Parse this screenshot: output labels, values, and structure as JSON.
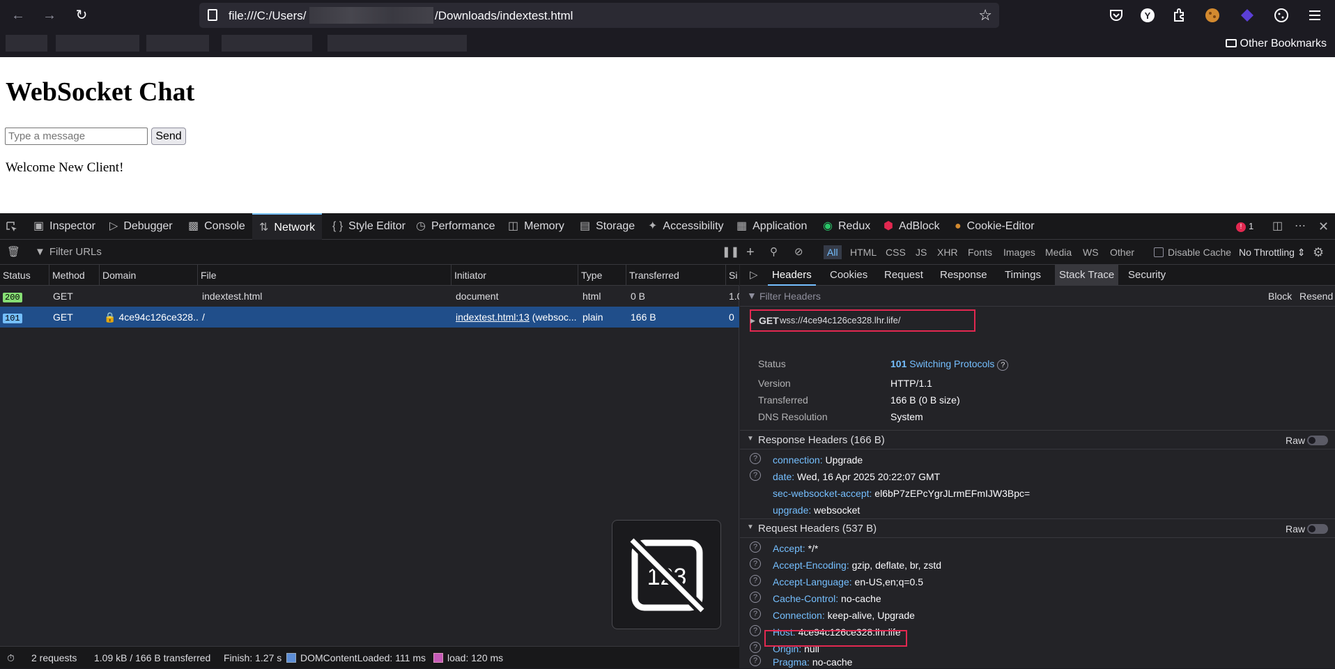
{
  "browser": {
    "url_prefix": "file:///C:/Users/",
    "url_suffix": "/Downloads/indextest.html",
    "bookmarks": {
      "other": "Other Bookmarks"
    }
  },
  "page": {
    "title": "WebSocket Chat",
    "message_placeholder": "Type a message",
    "send_label": "Send",
    "welcome": "Welcome New Client!"
  },
  "devtools": {
    "tabs": [
      "Inspector",
      "Debugger",
      "Console",
      "Network",
      "Style Editor",
      "Performance",
      "Memory",
      "Storage",
      "Accessibility",
      "Application",
      "Redux",
      "AdBlock",
      "Cookie-Editor"
    ],
    "active_tab": "Network",
    "error_count": "1",
    "filter_placeholder": "Filter URLs",
    "type_filters": [
      "All",
      "HTML",
      "CSS",
      "JS",
      "XHR",
      "Fonts",
      "Images",
      "Media",
      "WS",
      "Other"
    ],
    "disable_cache": "Disable Cache",
    "throttling": "No Throttling",
    "columns": [
      "Status",
      "Method",
      "Domain",
      "File",
      "Initiator",
      "Type",
      "Transferred",
      "Si"
    ],
    "requests": [
      {
        "status": "200",
        "method": "GET",
        "domain": "",
        "file": "indextest.html",
        "initiator": "document",
        "initiator_suffix": "",
        "type": "html",
        "transferred": "0 B",
        "size": "1.0"
      },
      {
        "status": "101",
        "method": "GET",
        "domain": "4ce94c126ce328...",
        "file": "/",
        "initiator": "indextest.html:13",
        "initiator_suffix": " (websoc...",
        "type": "plain",
        "transferred": "166 B",
        "size": "0"
      }
    ],
    "statusbar": {
      "requests": "2 requests",
      "transferred": "1.09 kB / 166 B transferred",
      "finish": "Finish: 1.27 s",
      "domcontentloaded": "DOMContentLoaded: 111 ms",
      "load": "load: 120 ms"
    },
    "details": {
      "tabs": [
        "Headers",
        "Cookies",
        "Request",
        "Response",
        "Timings",
        "Stack Trace",
        "Security"
      ],
      "active_tab": "Headers",
      "filter_placeholder": "Filter Headers",
      "block": "Block",
      "resend": "Resend",
      "method": "GET",
      "url": "wss://4ce94c126ce328.lhr.life/",
      "summary": {
        "status_label": "Status",
        "status_code": "101",
        "status_text": "Switching Protocols",
        "version_label": "Version",
        "version": "HTTP/1.1",
        "transferred_label": "Transferred",
        "transferred": "166 B (0 B size)",
        "dns_label": "DNS Resolution",
        "dns": "System"
      },
      "response_headers_title": "Response Headers (166 B)",
      "response_headers": [
        {
          "name": "connection:",
          "value": "Upgrade"
        },
        {
          "name": "date:",
          "value": "Wed, 16 Apr 2025 20:22:07 GMT"
        },
        {
          "name": "sec-websocket-accept:",
          "value": "el6bP7zEPcYgrJLrmEFmIJW3Bpc="
        },
        {
          "name": "upgrade:",
          "value": "websocket"
        }
      ],
      "request_headers_title": "Request Headers (537 B)",
      "request_headers": [
        {
          "name": "Accept:",
          "value": "*/*"
        },
        {
          "name": "Accept-Encoding:",
          "value": "gzip, deflate, br, zstd"
        },
        {
          "name": "Accept-Language:",
          "value": "en-US,en;q=0.5"
        },
        {
          "name": "Cache-Control:",
          "value": "no-cache"
        },
        {
          "name": "Connection:",
          "value": "keep-alive, Upgrade"
        },
        {
          "name": "Host:",
          "value": "4ce94c126ce328.lhr.life"
        },
        {
          "name": "Origin:",
          "value": "null"
        },
        {
          "name": "Pragma:",
          "value": "no-cache"
        }
      ],
      "raw": "Raw"
    }
  },
  "colors": {
    "accent": "#75bfff",
    "status_200": "#86de74",
    "status_101": "#75bfff",
    "highlight_box": "#e22850"
  }
}
